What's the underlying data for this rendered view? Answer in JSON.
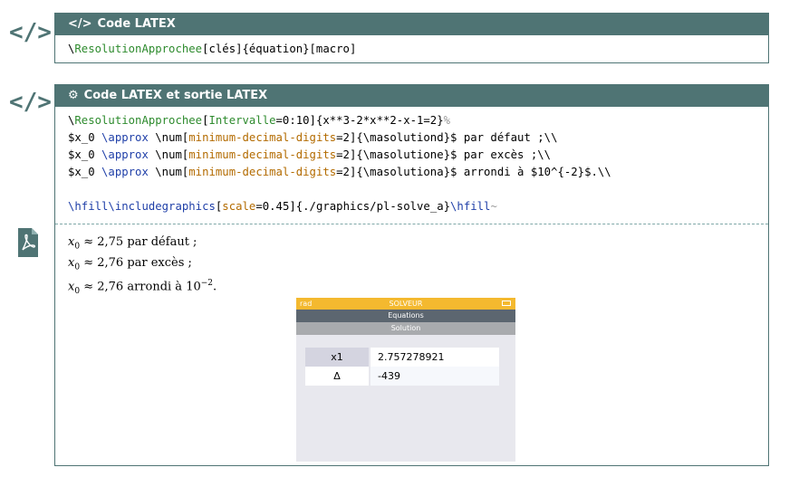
{
  "box1": {
    "title": "Code LATEX",
    "code_line": {
      "bs": "\\",
      "cmd": "ResolutionApprochee",
      "rest": "[clés]{équation}[macro]"
    }
  },
  "box2": {
    "title": "Code LATEX et sortie LATEX",
    "lines": {
      "l1": {
        "bs": "\\",
        "cmd": "ResolutionApprochee",
        "b1": "[",
        "key": "Intervalle",
        "val": "=0:10]{x**3-2*x**2-x-1=2}",
        "pct": "%"
      },
      "l2": {
        "a": "$x_0 ",
        "approx": "\\approx",
        "b": " \\num[",
        "key": "minimum-decimal-digits",
        "c": "=2]{\\masolutiond}$ par défaut ;\\\\"
      },
      "l3": {
        "a": "$x_0 ",
        "approx": "\\approx",
        "b": " \\num[",
        "key": "minimum-decimal-digits",
        "c": "=2]{\\masolutione}$ par excès ;\\\\"
      },
      "l4": {
        "a": "$x_0 ",
        "approx": "\\approx",
        "b": " \\num[",
        "key": "minimum-decimal-digits",
        "c": "=2]{\\masolutiona}$ arrondi à $10^{-2}$.\\\\"
      },
      "l6": {
        "hfill1": "\\hfill",
        "incl": "\\includegraphics",
        "b": "[",
        "key": "scale",
        "c": "=0.45]{./graphics/pl-solve_a}",
        "hfill2": "\\hfill",
        "tilde": "~"
      }
    },
    "output": {
      "o1": "≈ 2,75 par défaut ;",
      "o2": "≈ 2,76 par excès ;",
      "o3a": "≈ 2,76 arrondi à 10",
      "o3exp": "−2",
      "o3end": ".",
      "var": "x",
      "sub": "0"
    }
  },
  "calc": {
    "mode": "rad",
    "title": "SOLVEUR",
    "bar1": "Equations",
    "bar2": "Solution",
    "rows": [
      {
        "key": "x1",
        "value": "2.757278921"
      },
      {
        "key": "Δ",
        "value": "-439"
      }
    ]
  }
}
